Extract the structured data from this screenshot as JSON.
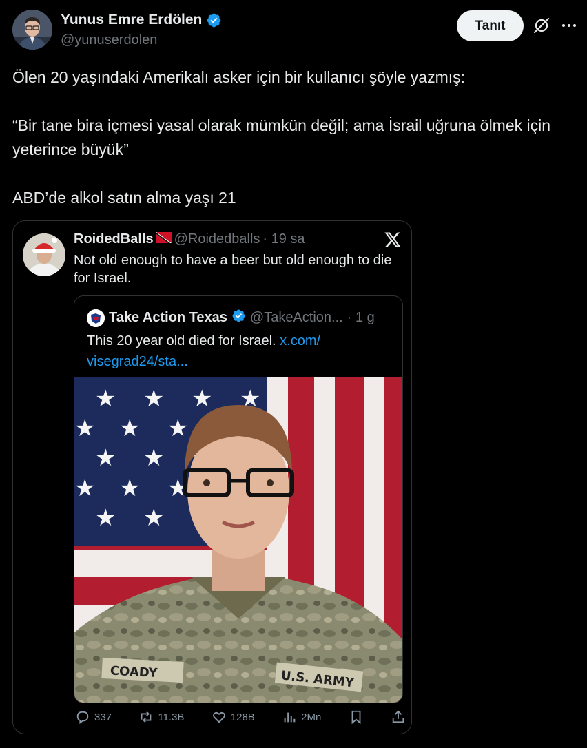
{
  "author": {
    "display_name": "Yunus Emre Erdölen",
    "handle": "@yunuserdolen",
    "verified": true
  },
  "header": {
    "follow_label": "Tanıt",
    "grok_icon": "grok-slash-icon",
    "more_icon": "more-dots-icon"
  },
  "tweet": {
    "line1": "Ölen 20 yaşındaki Amerikalı asker için bir kullanıcı şöyle yazmış:",
    "line2": "“Bir tane bira içmesi yasal olarak mümkün değil; ama İsrail uğruna ölmek için yeterince büyük”",
    "line3": "ABD’de alkol satın alma yaşı 21"
  },
  "embedded": {
    "name": "RoidedBalls",
    "handle": "@Roidedballs",
    "time": "· 19 sa",
    "text": "Not old enough to have a beer but old enough to die for Israel.",
    "quoted": {
      "name": "Take Action Texas",
      "handle": "@TakeAction...",
      "time": "· 1 g",
      "text": "This 20 year old died for Israel.",
      "link": "x.com/ visegrad24/sta..."
    },
    "photo": {
      "name_tape": "COADY",
      "branch_tape": "U.S. ARMY"
    },
    "stats": {
      "replies": "337",
      "reposts": "11.3B",
      "likes": "128B",
      "views": "2Mn"
    }
  },
  "colors": {
    "background": "#000000",
    "text": "#e7e9ea",
    "muted": "#71767b",
    "link": "#1d9bf0",
    "verified": "#1d9bf0",
    "follow_bg": "#eff3f4"
  }
}
